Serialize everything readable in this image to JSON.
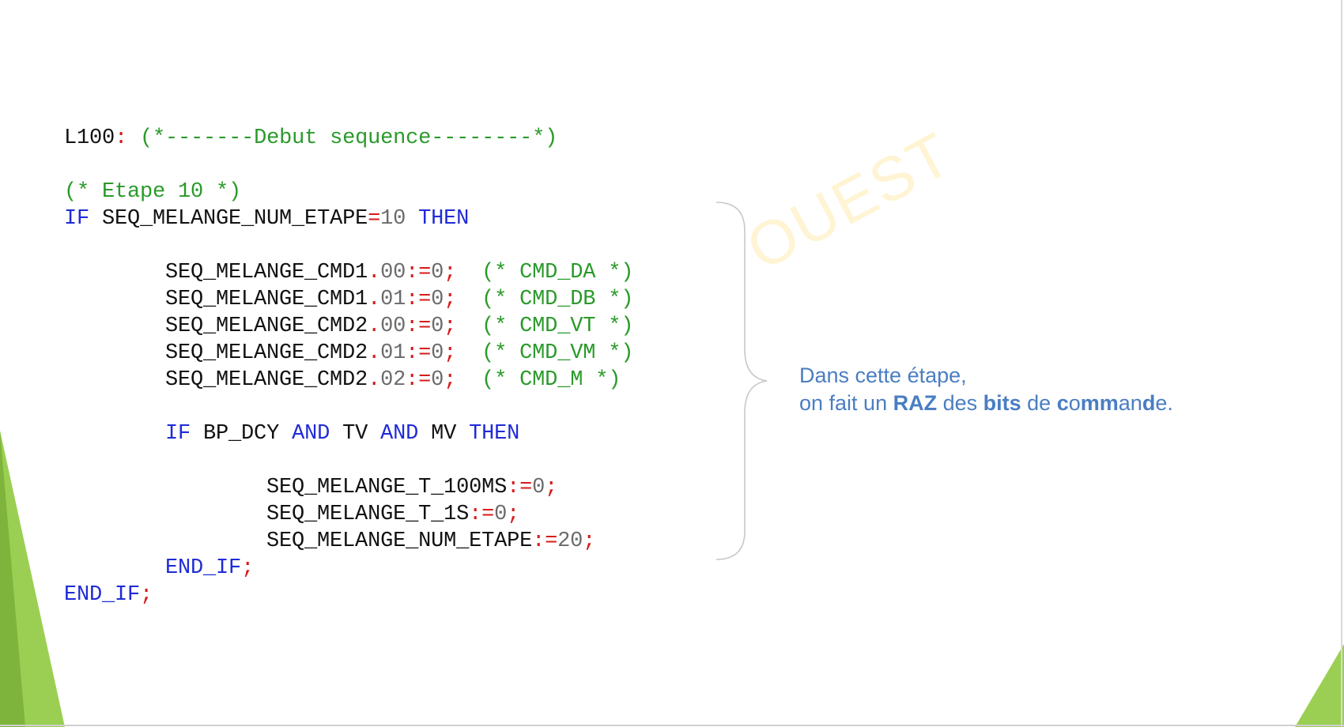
{
  "code": {
    "lines": [
      [
        {
          "t": "L100",
          "k": "plain"
        },
        {
          "t": ":",
          "k": "operator"
        },
        {
          "t": " ",
          "k": "plain"
        },
        {
          "t": "(*-------Debut sequence--------*)",
          "k": "comment"
        }
      ],
      [],
      [
        {
          "t": "(* Etape 10 *)",
          "k": "comment"
        }
      ],
      [
        {
          "t": "IF",
          "k": "keyword"
        },
        {
          "t": " SEQ_MELANGE_NUM_ETAPE",
          "k": "plain"
        },
        {
          "t": "=",
          "k": "operator"
        },
        {
          "t": "10",
          "k": "number"
        },
        {
          "t": " ",
          "k": "plain"
        },
        {
          "t": "THEN",
          "k": "keyword"
        }
      ],
      [],
      [
        {
          "t": "        SEQ_MELANGE_CMD1",
          "k": "plain"
        },
        {
          "t": ".",
          "k": "operator"
        },
        {
          "t": "00",
          "k": "number"
        },
        {
          "t": ":=",
          "k": "operator"
        },
        {
          "t": "0",
          "k": "number"
        },
        {
          "t": ";",
          "k": "operator"
        },
        {
          "t": "  ",
          "k": "plain"
        },
        {
          "t": "(* CMD_DA *)",
          "k": "comment"
        }
      ],
      [
        {
          "t": "        SEQ_MELANGE_CMD1",
          "k": "plain"
        },
        {
          "t": ".",
          "k": "operator"
        },
        {
          "t": "01",
          "k": "number"
        },
        {
          "t": ":=",
          "k": "operator"
        },
        {
          "t": "0",
          "k": "number"
        },
        {
          "t": ";",
          "k": "operator"
        },
        {
          "t": "  ",
          "k": "plain"
        },
        {
          "t": "(* CMD_DB *)",
          "k": "comment"
        }
      ],
      [
        {
          "t": "        SEQ_MELANGE_CMD2",
          "k": "plain"
        },
        {
          "t": ".",
          "k": "operator"
        },
        {
          "t": "00",
          "k": "number"
        },
        {
          "t": ":=",
          "k": "operator"
        },
        {
          "t": "0",
          "k": "number"
        },
        {
          "t": ";",
          "k": "operator"
        },
        {
          "t": "  ",
          "k": "plain"
        },
        {
          "t": "(* CMD_VT *)",
          "k": "comment"
        }
      ],
      [
        {
          "t": "        SEQ_MELANGE_CMD2",
          "k": "plain"
        },
        {
          "t": ".",
          "k": "operator"
        },
        {
          "t": "01",
          "k": "number"
        },
        {
          "t": ":=",
          "k": "operator"
        },
        {
          "t": "0",
          "k": "number"
        },
        {
          "t": ";",
          "k": "operator"
        },
        {
          "t": "  ",
          "k": "plain"
        },
        {
          "t": "(* CMD_VM *)",
          "k": "comment"
        }
      ],
      [
        {
          "t": "        SEQ_MELANGE_CMD2",
          "k": "plain"
        },
        {
          "t": ".",
          "k": "operator"
        },
        {
          "t": "02",
          "k": "number"
        },
        {
          "t": ":=",
          "k": "operator"
        },
        {
          "t": "0",
          "k": "number"
        },
        {
          "t": ";",
          "k": "operator"
        },
        {
          "t": "  ",
          "k": "plain"
        },
        {
          "t": "(* CMD_M *)",
          "k": "comment"
        }
      ],
      [],
      [
        {
          "t": "        ",
          "k": "plain"
        },
        {
          "t": "IF",
          "k": "keyword"
        },
        {
          "t": " BP_DCY ",
          "k": "plain"
        },
        {
          "t": "AND",
          "k": "keyword"
        },
        {
          "t": " TV ",
          "k": "plain"
        },
        {
          "t": "AND",
          "k": "keyword"
        },
        {
          "t": " MV ",
          "k": "plain"
        },
        {
          "t": "THEN",
          "k": "keyword"
        }
      ],
      [],
      [
        {
          "t": "                SEQ_MELANGE_T_100MS",
          "k": "plain"
        },
        {
          "t": ":=",
          "k": "operator"
        },
        {
          "t": "0",
          "k": "number"
        },
        {
          "t": ";",
          "k": "operator"
        }
      ],
      [
        {
          "t": "                SEQ_MELANGE_T_1S",
          "k": "plain"
        },
        {
          "t": ":=",
          "k": "operator"
        },
        {
          "t": "0",
          "k": "number"
        },
        {
          "t": ";",
          "k": "operator"
        }
      ],
      [
        {
          "t": "                SEQ_MELANGE_NUM_ETAPE",
          "k": "plain"
        },
        {
          "t": ":=",
          "k": "operator"
        },
        {
          "t": "20",
          "k": "number"
        },
        {
          "t": ";",
          "k": "operator"
        }
      ],
      [
        {
          "t": "        ",
          "k": "plain"
        },
        {
          "t": "END_IF",
          "k": "keyword"
        },
        {
          "t": ";",
          "k": "operator"
        }
      ],
      [
        {
          "t": "END_IF",
          "k": "keyword"
        },
        {
          "t": ";",
          "k": "operator"
        }
      ]
    ]
  },
  "watermark": "OUEST",
  "annotation": {
    "line1": "Dans cette étape,",
    "line2_parts": [
      {
        "t": "on fait un ",
        "b": false
      },
      {
        "t": "RAZ",
        "b": true
      },
      {
        "t": " des ",
        "b": false
      },
      {
        "t": "bits",
        "b": true
      },
      {
        "t": " de ",
        "b": false
      },
      {
        "t": "c",
        "b": true
      },
      {
        "t": "o",
        "b": false
      },
      {
        "t": "mm",
        "b": true
      },
      {
        "t": "an",
        "b": false
      },
      {
        "t": "d",
        "b": true
      },
      {
        "t": "e.",
        "b": false
      }
    ]
  },
  "colors": {
    "keyword": "#1f2bd6",
    "comment": "#2a9a2a",
    "operator": "#d81b1b",
    "number": "#6b6b6b",
    "annotation": "#4a7ec2",
    "accent_green": "#8cc63f"
  }
}
